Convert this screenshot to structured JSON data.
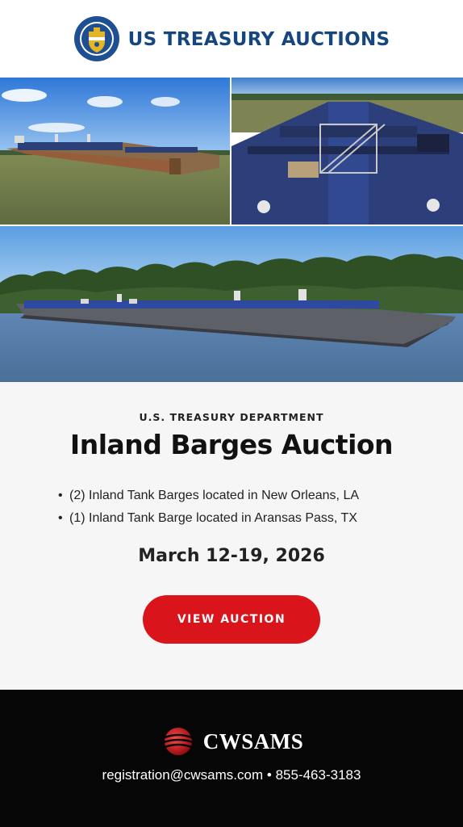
{
  "header": {
    "brand_name": "US TREASURY AUCTIONS",
    "seal_icon": "treasury-seal-icon",
    "brand_color": "#16467f"
  },
  "photos": [
    {
      "name": "barge-side-view-photo"
    },
    {
      "name": "barge-deck-walkway-photo"
    },
    {
      "name": "barge-river-tree-line-photo"
    }
  ],
  "info": {
    "eyebrow": "U.S. TREASURY DEPARTMENT",
    "title": "Inland Barges Auction",
    "bullets": [
      "(2) Inland Tank Barges located in New Orleans, LA",
      "(1) Inland Tank Barge located in Aransas Pass, TX"
    ],
    "date": "March 12-19, 2026",
    "cta_label": "VIEW AUCTION",
    "cta_color": "#d9141b"
  },
  "footer": {
    "logo_text": "CWSAMS",
    "logo_icon": "cwsams-sphere-icon",
    "email": "registration@cwsams.com",
    "separator": "•",
    "phone": "855-463-3183"
  }
}
